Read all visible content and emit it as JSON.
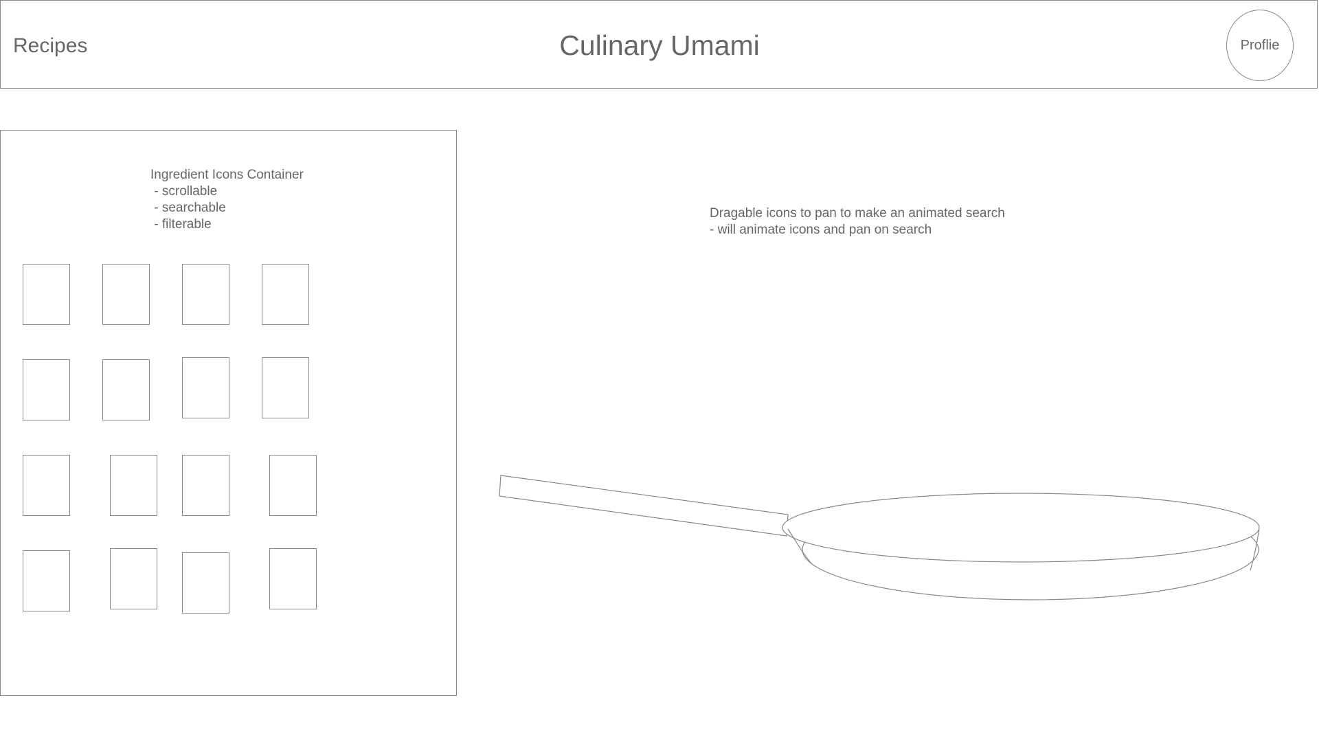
{
  "header": {
    "nav_label": "Recipes",
    "title": "Culinary Umami",
    "profile_label": "Proflie"
  },
  "ingredient_container": {
    "note": "Ingredient Icons Container\n - scrollable\n - searchable\n - filterable",
    "icon_count": 16
  },
  "pan_area": {
    "note": "Dragable icons to pan to make an animated search\n- will animate icons and pan on search"
  },
  "colors": {
    "stroke": "#888888",
    "text": "#666666",
    "background": "#ffffff"
  }
}
